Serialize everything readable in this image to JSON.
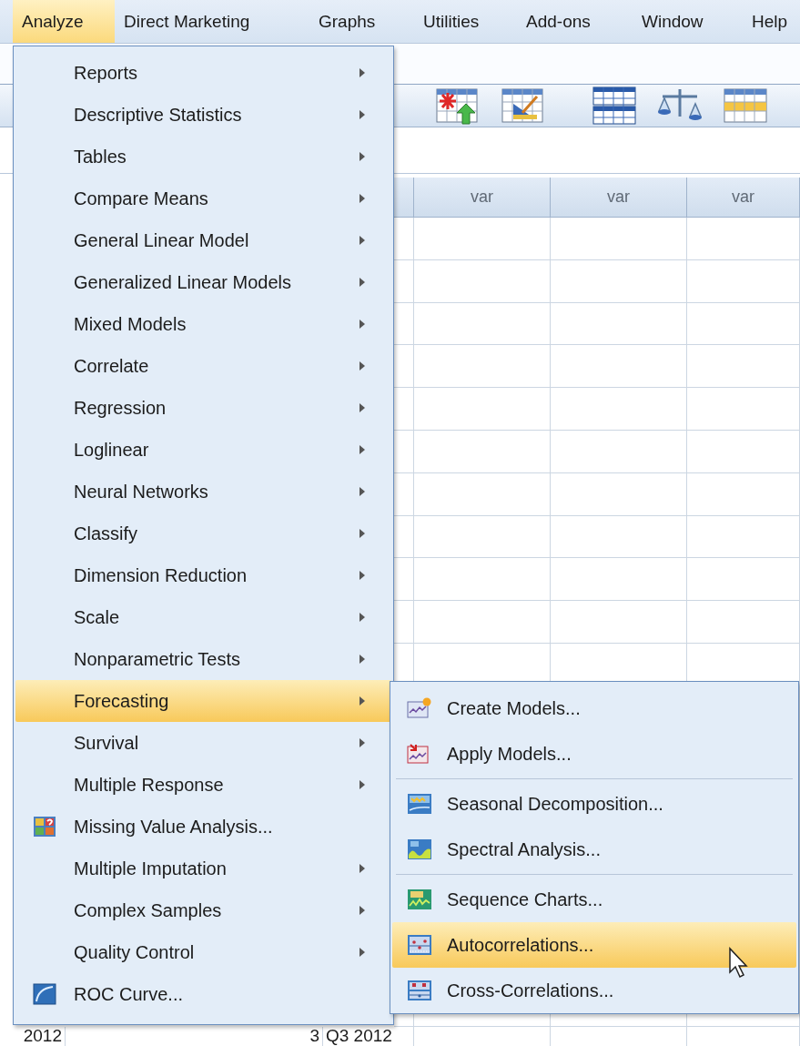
{
  "menubar": [
    {
      "label": "Analyze",
      "selected": true
    },
    {
      "label": "Direct Marketing",
      "selected": false
    },
    {
      "label": "Graphs",
      "selected": false
    },
    {
      "label": "Utilities",
      "selected": false
    },
    {
      "label": "Add-ons",
      "selected": false
    },
    {
      "label": "Window",
      "selected": false
    },
    {
      "label": "Help",
      "selected": false
    }
  ],
  "data_view": {
    "columns": [
      "var",
      "var",
      "var"
    ],
    "last_row": [
      "2012",
      "3",
      "Q3 2012"
    ]
  },
  "analyze_menu": {
    "items": [
      {
        "label": "Reports",
        "kind": "submenu",
        "selected": false
      },
      {
        "label": "Descriptive Statistics",
        "kind": "submenu",
        "selected": false
      },
      {
        "label": "Tables",
        "kind": "submenu",
        "selected": false
      },
      {
        "label": "Compare Means",
        "kind": "submenu",
        "selected": false
      },
      {
        "label": "General Linear Model",
        "kind": "submenu",
        "selected": false
      },
      {
        "label": "Generalized Linear Models",
        "kind": "submenu",
        "selected": false
      },
      {
        "label": "Mixed Models",
        "kind": "submenu",
        "selected": false
      },
      {
        "label": "Correlate",
        "kind": "submenu",
        "selected": false
      },
      {
        "label": "Regression",
        "kind": "submenu",
        "selected": false
      },
      {
        "label": "Loglinear",
        "kind": "submenu",
        "selected": false
      },
      {
        "label": "Neural Networks",
        "kind": "submenu",
        "selected": false
      },
      {
        "label": "Classify",
        "kind": "submenu",
        "selected": false
      },
      {
        "label": "Dimension Reduction",
        "kind": "submenu",
        "selected": false
      },
      {
        "label": "Scale",
        "kind": "submenu",
        "selected": false
      },
      {
        "label": "Nonparametric Tests",
        "kind": "submenu",
        "selected": false
      },
      {
        "label": "Forecasting",
        "kind": "submenu",
        "selected": true
      },
      {
        "label": "Survival",
        "kind": "submenu",
        "selected": false
      },
      {
        "label": "Multiple Response",
        "kind": "submenu",
        "selected": false
      },
      {
        "label": "Missing Value Analysis...",
        "kind": "command",
        "selected": false
      },
      {
        "label": "Multiple Imputation",
        "kind": "submenu",
        "selected": false
      },
      {
        "label": "Complex Samples",
        "kind": "submenu",
        "selected": false
      },
      {
        "label": "Quality Control",
        "kind": "submenu",
        "selected": false
      },
      {
        "label": "ROC Curve...",
        "kind": "command",
        "selected": false
      }
    ]
  },
  "forecasting_submenu": {
    "groups": [
      {
        "items": [
          {
            "label": "Create Models...",
            "kind": "command",
            "selected": false
          },
          {
            "label": "Apply Models...",
            "kind": "command",
            "selected": false
          }
        ]
      },
      {
        "items": [
          {
            "label": "Seasonal Decomposition...",
            "kind": "command",
            "selected": false
          },
          {
            "label": "Spectral Analysis...",
            "kind": "command",
            "selected": false
          }
        ]
      },
      {
        "items": [
          {
            "label": "Sequence Charts...",
            "kind": "command",
            "selected": false
          },
          {
            "label": "Autocorrelations...",
            "kind": "command",
            "selected": true
          },
          {
            "label": "Cross-Correlations...",
            "kind": "command",
            "selected": false
          }
        ]
      }
    ]
  }
}
